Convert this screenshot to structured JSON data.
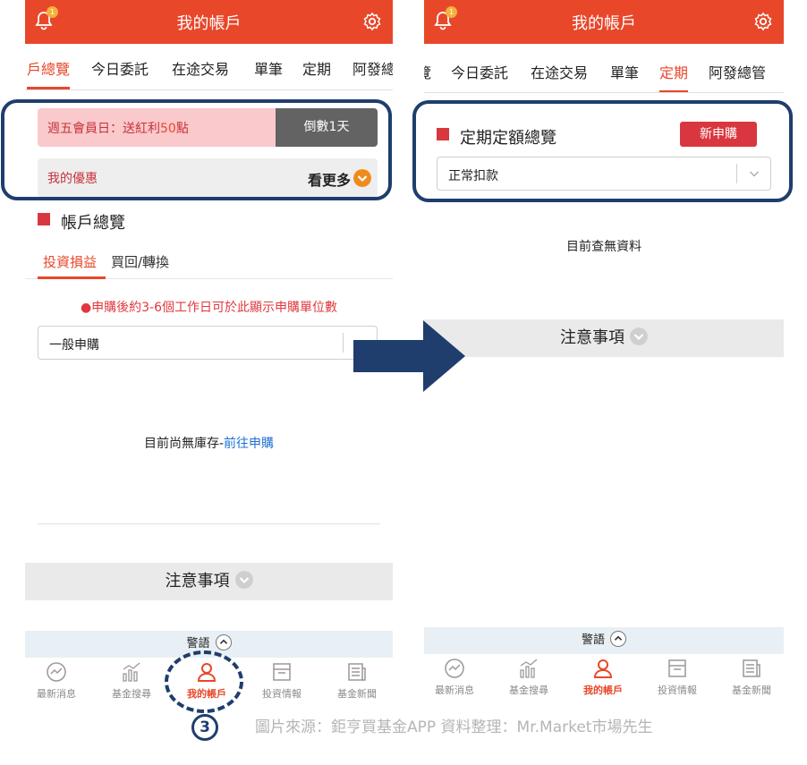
{
  "left": {
    "header_title": "我的帳戶",
    "notification_count": "1",
    "tabs": [
      "戶總覽",
      "今日委託",
      "在途交易",
      "單筆",
      "定期",
      "阿發總"
    ],
    "promo": {
      "text_prefix": "週五會員日：送紅利",
      "text_highlight": "50",
      "text_suffix": "點",
      "countdown": "倒數1天"
    },
    "offer": {
      "label": "我的優惠",
      "more": "看更多"
    },
    "section_title": "帳戶總覽",
    "subtabs": [
      "投資損益",
      "買回/轉換"
    ],
    "notice": "●申購後約3-6個工作日可於此顯示申購單位數",
    "select_value": "一般申購",
    "empty_text": "目前尚無庫存-",
    "empty_link": "前往申購",
    "notes": "注意事項",
    "warning": "警語",
    "nav": [
      "最新消息",
      "基金搜尋",
      "我的帳戶",
      "投資情報",
      "基金新聞"
    ],
    "active_nav_index": 2
  },
  "right": {
    "header_title": "我的帳戶",
    "notification_count": "1",
    "tabs": [
      "覽",
      "今日委託",
      "在途交易",
      "單筆",
      "定期",
      "阿發總管"
    ],
    "section_title": "定期定額總覽",
    "new_button": "新申購",
    "select_value": "正常扣款",
    "no_data": "目前查無資料",
    "notes": "注意事項",
    "warning": "警語",
    "nav": [
      "最新消息",
      "基金搜尋",
      "我的帳戶",
      "投資情報",
      "基金新聞"
    ],
    "active_nav_index": 2
  },
  "annotation": {
    "step_number": "3",
    "credit": "圖片來源：鉅亨買基金APP  資料整理：Mr.Market市場先生"
  },
  "colors": {
    "header_red": "#e8472a",
    "annotation_navy": "#1f3e6d",
    "promo_pink": "#f9c9cc",
    "link_blue": "#1f6fd1"
  }
}
